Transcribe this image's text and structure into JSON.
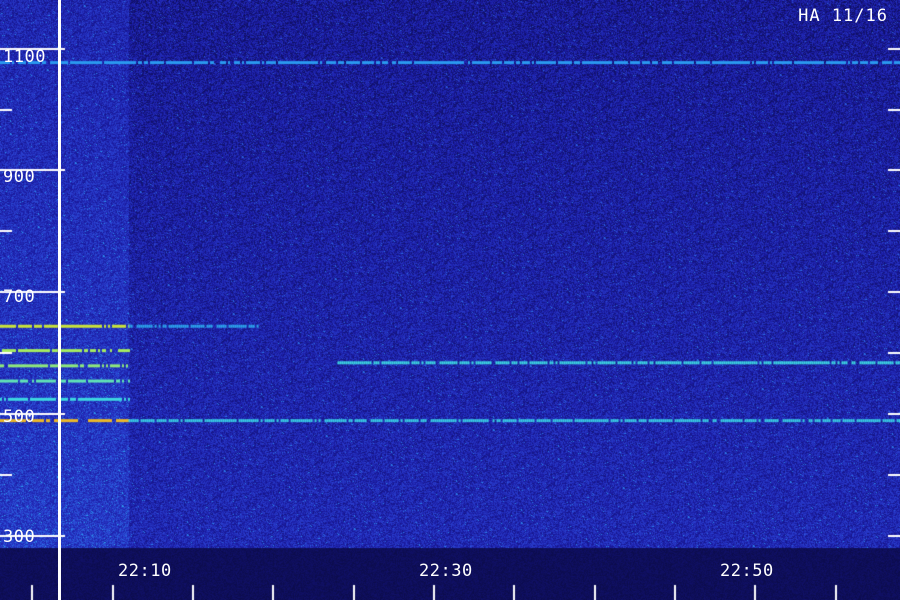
{
  "chart_data": {
    "type": "heatmap",
    "title": "HA 11/16",
    "xlabel": "",
    "ylabel": "",
    "x_tick_labels": [
      "22:10",
      "22:30",
      "22:50"
    ],
    "y_tick_labels": [
      "1100",
      "900",
      "700",
      "500",
      "300"
    ],
    "y_range": [
      280,
      1180
    ],
    "x_range": [
      "22:04",
      "23:00"
    ],
    "colormap": [
      "#0a0a40",
      "#1a1aa0",
      "#2a3fd0",
      "#2a9af0",
      "#40e0e0",
      "#c0f040",
      "#ffa020"
    ],
    "bright_bands": [
      {
        "freq": 645,
        "start": "22:04",
        "end": "22:12",
        "level": 0.85
      },
      {
        "freq": 605,
        "start": "22:04",
        "end": "22:12",
        "level": 0.75
      },
      {
        "freq": 580,
        "start": "22:04",
        "end": "22:12",
        "level": 0.7
      },
      {
        "freq": 555,
        "start": "22:04",
        "end": "22:12",
        "level": 0.6
      },
      {
        "freq": 525,
        "start": "22:04",
        "end": "22:12",
        "level": 0.5
      },
      {
        "freq": 490,
        "start": "22:04",
        "end": "22:12",
        "level": 1.0
      },
      {
        "freq": 490,
        "start": "22:12",
        "end": "23:00",
        "level": 0.45
      },
      {
        "freq": 585,
        "start": "22:25",
        "end": "23:00",
        "level": 0.5
      },
      {
        "freq": 645,
        "start": "22:12",
        "end": "22:20",
        "level": 0.3
      },
      {
        "freq": 1078,
        "start": "22:04",
        "end": "23:00",
        "level": 0.25
      }
    ],
    "grid": false
  }
}
